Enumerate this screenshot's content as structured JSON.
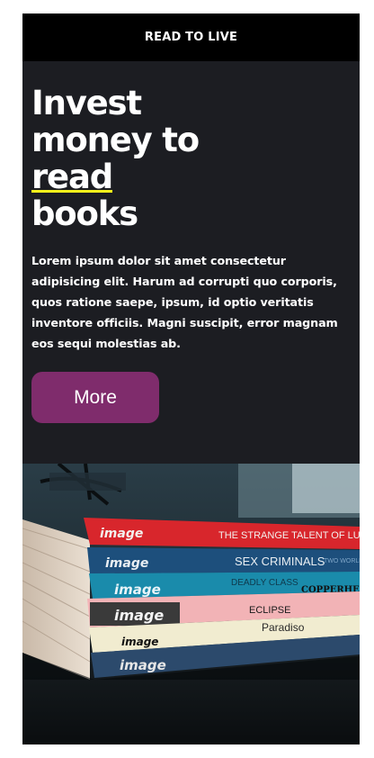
{
  "header": {
    "brand": "READ TO LIVE"
  },
  "hero": {
    "headline_line1": "Invest",
    "headline_line2": "money to",
    "headline_highlight": "read",
    "headline_line4": "books",
    "body": "Lorem ipsum dolor sit amet consectetur adipisicing elit. Harum ad corrupti quo corporis, quos ratione saepe, ipsum, id optio veritatis inventore officiis. Magni suscipit, error magnam eos sequi molestias ab.",
    "button_label": "More"
  },
  "colors": {
    "page_background": "#1c1d22",
    "header_background": "#000000",
    "accent_underline": "#f5f21b",
    "button_background": "#7f2c6c",
    "text": "#ffffff"
  },
  "photo": {
    "description_icon": "stacked-comics-photo",
    "books": [
      {
        "publisher": "image",
        "title": "THE STRANGE TALENT OF LUTHER",
        "spine_color": "#d8262c"
      },
      {
        "publisher": "image",
        "title": "SEX CRIMINALS",
        "subtitle": "TWO WORLDS",
        "spine_color": "#1d4f7c"
      },
      {
        "publisher": "image",
        "title": "DEADLY CLASS",
        "spine_color": "#1a8bab"
      },
      {
        "publisher": "image",
        "title": "COPPERHEAD",
        "spine_color": "#f2b3b6"
      },
      {
        "publisher": "image",
        "title": "ECLIPSE",
        "spine_color": "#f1ecd0"
      },
      {
        "publisher": "image",
        "title": "Paradiso",
        "spine_color": "#2c4a6c"
      }
    ]
  }
}
